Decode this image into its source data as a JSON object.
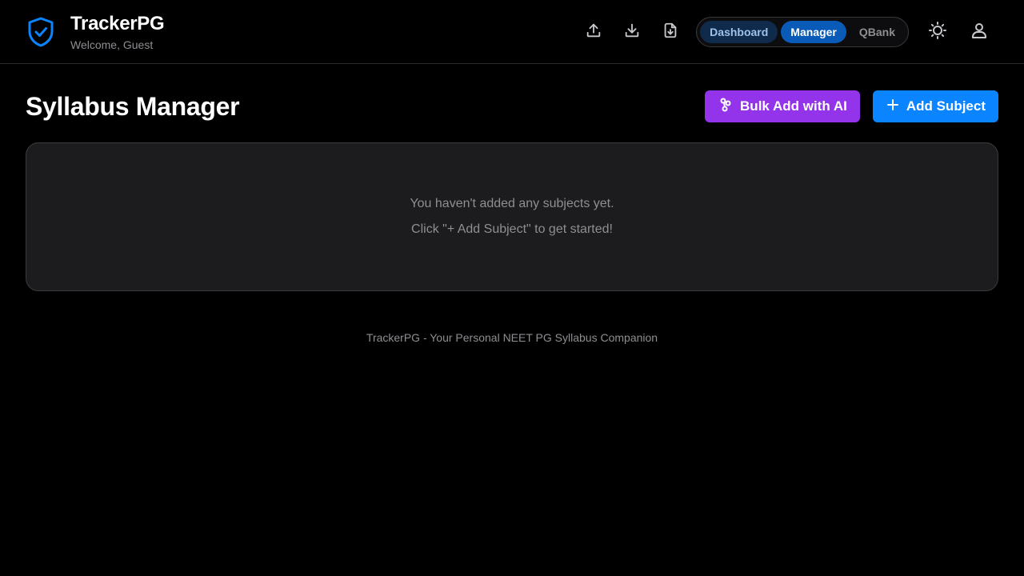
{
  "app": {
    "title": "TrackerPG",
    "welcome": "Welcome, Guest",
    "accent": "#0a84ff"
  },
  "toolbar": {
    "upload_icon": "upload-icon",
    "download_icon": "download-icon",
    "import_icon": "file-download-icon"
  },
  "nav": {
    "items": [
      {
        "label": "Dashboard"
      },
      {
        "label": "Manager",
        "active": true
      },
      {
        "label": "QBank"
      }
    ]
  },
  "utilities": {
    "theme_icon": "sun-icon",
    "profile_icon": "user-icon"
  },
  "main": {
    "page_title": "Syllabus Manager",
    "bulk_add_label": "Bulk Add with AI",
    "bulk_add_color": "#9333ea",
    "add_subject_label": "Add Subject",
    "add_subject_color": "#0a84ff",
    "empty_line1": "You haven't added any subjects yet.",
    "empty_line2": "Click \"+ Add Subject\" to get started!"
  },
  "footer": {
    "text": "TrackerPG - Your Personal NEET PG Syllabus Companion"
  }
}
